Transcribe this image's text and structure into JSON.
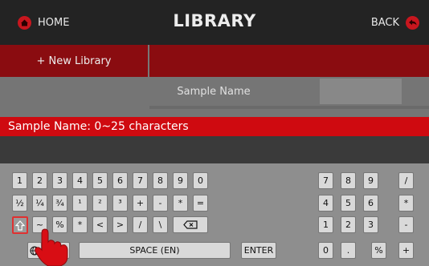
{
  "header": {
    "home_label": "HOME",
    "title": "LIBRARY",
    "back_label": "BACK",
    "new_library_label": "+ New Library"
  },
  "table": {
    "column_header": "Sample Name"
  },
  "hint": {
    "text": "Sample Name: 0~25 characters"
  },
  "keyboard": {
    "main_keys": [
      {
        "label": "1"
      },
      {
        "label": "2"
      },
      {
        "label": "3"
      },
      {
        "label": "4"
      },
      {
        "label": "5"
      },
      {
        "label": "6"
      },
      {
        "label": "7"
      },
      {
        "label": "8"
      },
      {
        "label": "9"
      },
      {
        "label": "0"
      },
      {
        "label": "½"
      },
      {
        "label": "¼"
      },
      {
        "label": "¾"
      },
      {
        "label": "¹"
      },
      {
        "label": "²"
      },
      {
        "label": "³"
      },
      {
        "label": "+"
      },
      {
        "label": "-"
      },
      {
        "label": "*"
      },
      {
        "label": "="
      },
      {
        "label": "~"
      },
      {
        "label": "%"
      },
      {
        "label": "*"
      },
      {
        "label": "<"
      },
      {
        "label": ">"
      },
      {
        "label": "/"
      },
      {
        "label": "\\"
      },
      {
        "label": "#"
      },
      {
        "label": "SPACE (EN)"
      },
      {
        "label": "ENTER"
      }
    ],
    "numpad_keys": [
      {
        "label": "7"
      },
      {
        "label": "8"
      },
      {
        "label": "9"
      },
      {
        "label": "/"
      },
      {
        "label": "4"
      },
      {
        "label": "5"
      },
      {
        "label": "6"
      },
      {
        "label": "*"
      },
      {
        "label": "1"
      },
      {
        "label": "2"
      },
      {
        "label": "3"
      },
      {
        "label": "-"
      },
      {
        "label": "0"
      },
      {
        "label": "."
      },
      {
        "label": "%"
      },
      {
        "label": "+"
      }
    ]
  },
  "colors": {
    "accent_red": "#cf0a10",
    "dark_red": "#8a0c10",
    "topbar": "#232323"
  },
  "icons": [
    "home-icon",
    "back-icon",
    "shift-icon",
    "backspace-icon",
    "globe-icon",
    "hand-pointer-icon"
  ]
}
